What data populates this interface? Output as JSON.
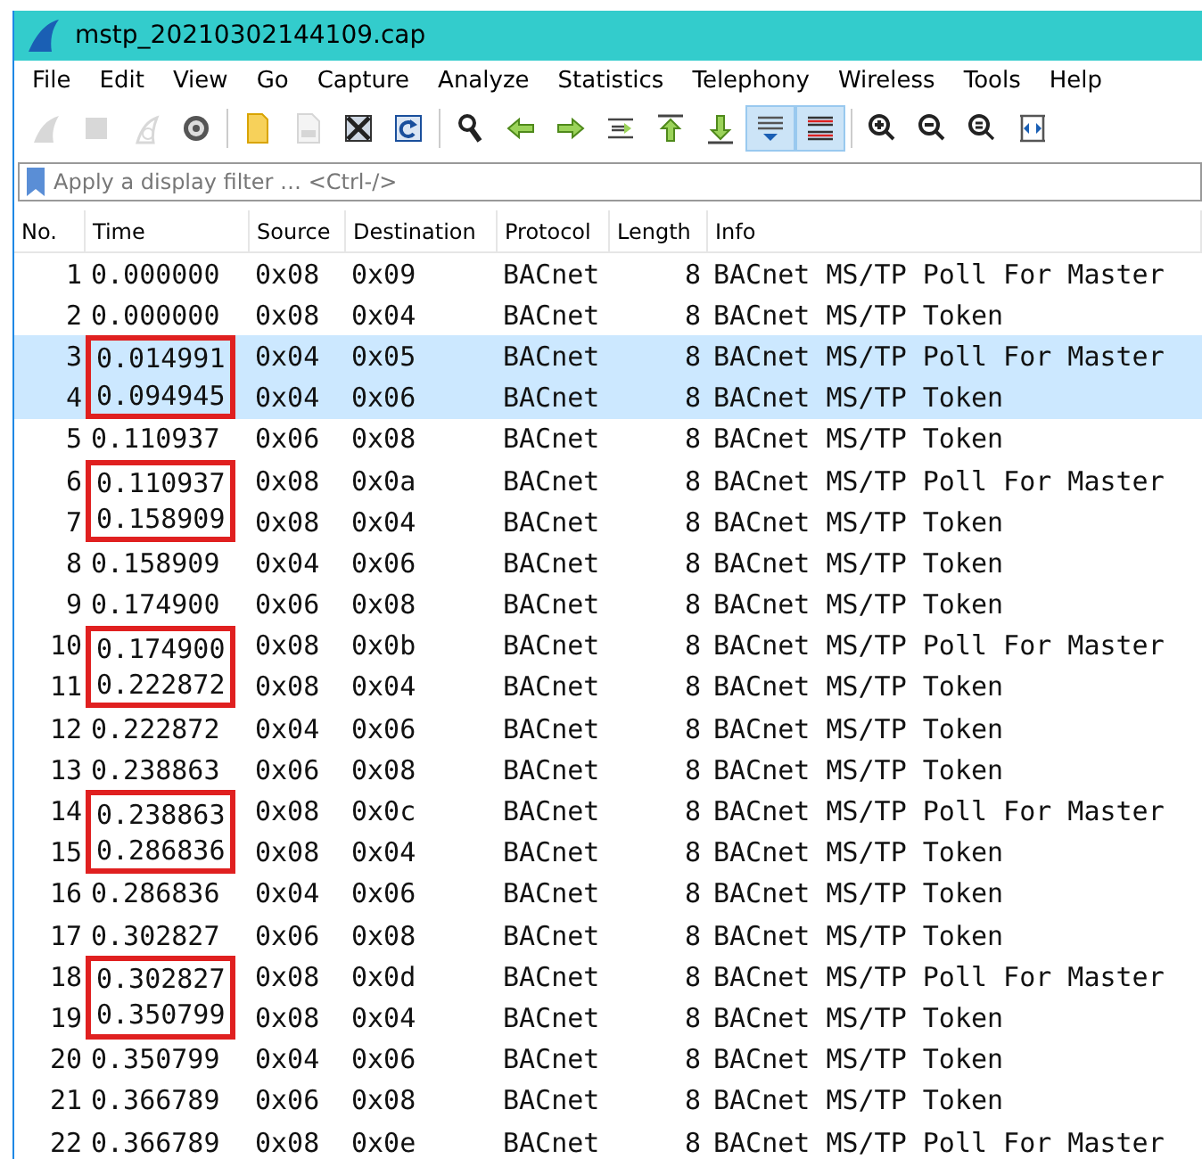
{
  "window": {
    "title": "mstp_20210302144109.cap"
  },
  "menu": [
    "File",
    "Edit",
    "View",
    "Go",
    "Capture",
    "Analyze",
    "Statistics",
    "Telephony",
    "Wireless",
    "Tools",
    "Help"
  ],
  "toolbar": [
    {
      "kind": "shark",
      "disabled": true,
      "pressed": false
    },
    {
      "kind": "stop",
      "disabled": true,
      "pressed": false
    },
    {
      "kind": "restart",
      "disabled": true,
      "pressed": false
    },
    {
      "kind": "options",
      "disabled": false,
      "pressed": false
    },
    {
      "kind": "separator"
    },
    {
      "kind": "open",
      "disabled": false,
      "pressed": false
    },
    {
      "kind": "save",
      "disabled": true,
      "pressed": false
    },
    {
      "kind": "close",
      "disabled": false,
      "pressed": false
    },
    {
      "kind": "reload",
      "disabled": false,
      "pressed": false
    },
    {
      "kind": "separator"
    },
    {
      "kind": "find",
      "disabled": false,
      "pressed": false
    },
    {
      "kind": "back",
      "disabled": false,
      "pressed": false
    },
    {
      "kind": "forward",
      "disabled": false,
      "pressed": false
    },
    {
      "kind": "goto",
      "disabled": false,
      "pressed": false
    },
    {
      "kind": "first",
      "disabled": false,
      "pressed": false
    },
    {
      "kind": "last",
      "disabled": false,
      "pressed": false
    },
    {
      "kind": "autoscroll",
      "disabled": false,
      "pressed": true
    },
    {
      "kind": "colorize",
      "disabled": false,
      "pressed": true
    },
    {
      "kind": "separator"
    },
    {
      "kind": "zoom-in",
      "disabled": false,
      "pressed": false
    },
    {
      "kind": "zoom-out",
      "disabled": false,
      "pressed": false
    },
    {
      "kind": "zoom-reset",
      "disabled": false,
      "pressed": false
    },
    {
      "kind": "resize",
      "disabled": false,
      "pressed": false
    }
  ],
  "filter": {
    "placeholder": "Apply a display filter … <Ctrl-/>"
  },
  "table": {
    "columns": [
      "No.",
      "Time",
      "Source",
      "Destination",
      "Protocol",
      "Length",
      "Info"
    ],
    "rows": [
      {
        "no": "1",
        "time": "0.000000",
        "source": "0x08",
        "destination": "0x09",
        "protocol": "BACnet",
        "length": "8",
        "info": "BACnet MS/TP Poll For Master",
        "selected": false,
        "boxed": false
      },
      {
        "no": "2",
        "time": "0.000000",
        "source": "0x08",
        "destination": "0x04",
        "protocol": "BACnet",
        "length": "8",
        "info": "BACnet MS/TP Token",
        "selected": false,
        "boxed": false
      },
      {
        "no": "3",
        "time": "0.014991",
        "source": "0x04",
        "destination": "0x05",
        "protocol": "BACnet",
        "length": "8",
        "info": "BACnet MS/TP Poll For Master",
        "selected": true,
        "boxed": true
      },
      {
        "no": "4",
        "time": "0.094945",
        "source": "0x04",
        "destination": "0x06",
        "protocol": "BACnet",
        "length": "8",
        "info": "BACnet MS/TP Token",
        "selected": true,
        "boxed": true
      },
      {
        "no": "5",
        "time": "0.110937",
        "source": "0x06",
        "destination": "0x08",
        "protocol": "BACnet",
        "length": "8",
        "info": "BACnet MS/TP Token",
        "selected": false,
        "boxed": false
      },
      {
        "no": "6",
        "time": "0.110937",
        "source": "0x08",
        "destination": "0x0a",
        "protocol": "BACnet",
        "length": "8",
        "info": "BACnet MS/TP Poll For Master",
        "selected": false,
        "boxed": true
      },
      {
        "no": "7",
        "time": "0.158909",
        "source": "0x08",
        "destination": "0x04",
        "protocol": "BACnet",
        "length": "8",
        "info": "BACnet MS/TP Token",
        "selected": false,
        "boxed": true
      },
      {
        "no": "8",
        "time": "0.158909",
        "source": "0x04",
        "destination": "0x06",
        "protocol": "BACnet",
        "length": "8",
        "info": "BACnet MS/TP Token",
        "selected": false,
        "boxed": false
      },
      {
        "no": "9",
        "time": "0.174900",
        "source": "0x06",
        "destination": "0x08",
        "protocol": "BACnet",
        "length": "8",
        "info": "BACnet MS/TP Token",
        "selected": false,
        "boxed": false
      },
      {
        "no": "10",
        "time": "0.174900",
        "source": "0x08",
        "destination": "0x0b",
        "protocol": "BACnet",
        "length": "8",
        "info": "BACnet MS/TP Poll For Master",
        "selected": false,
        "boxed": true
      },
      {
        "no": "11",
        "time": "0.222872",
        "source": "0x08",
        "destination": "0x04",
        "protocol": "BACnet",
        "length": "8",
        "info": "BACnet MS/TP Token",
        "selected": false,
        "boxed": true
      },
      {
        "no": "12",
        "time": "0.222872",
        "source": "0x04",
        "destination": "0x06",
        "protocol": "BACnet",
        "length": "8",
        "info": "BACnet MS/TP Token",
        "selected": false,
        "boxed": false
      },
      {
        "no": "13",
        "time": "0.238863",
        "source": "0x06",
        "destination": "0x08",
        "protocol": "BACnet",
        "length": "8",
        "info": "BACnet MS/TP Token",
        "selected": false,
        "boxed": false
      },
      {
        "no": "14",
        "time": "0.238863",
        "source": "0x08",
        "destination": "0x0c",
        "protocol": "BACnet",
        "length": "8",
        "info": "BACnet MS/TP Poll For Master",
        "selected": false,
        "boxed": true
      },
      {
        "no": "15",
        "time": "0.286836",
        "source": "0x08",
        "destination": "0x04",
        "protocol": "BACnet",
        "length": "8",
        "info": "BACnet MS/TP Token",
        "selected": false,
        "boxed": true
      },
      {
        "no": "16",
        "time": "0.286836",
        "source": "0x04",
        "destination": "0x06",
        "protocol": "BACnet",
        "length": "8",
        "info": "BACnet MS/TP Token",
        "selected": false,
        "boxed": false
      },
      {
        "no": "17",
        "time": "0.302827",
        "source": "0x06",
        "destination": "0x08",
        "protocol": "BACnet",
        "length": "8",
        "info": "BACnet MS/TP Token",
        "selected": false,
        "boxed": false
      },
      {
        "no": "18",
        "time": "0.302827",
        "source": "0x08",
        "destination": "0x0d",
        "protocol": "BACnet",
        "length": "8",
        "info": "BACnet MS/TP Poll For Master",
        "selected": false,
        "boxed": true
      },
      {
        "no": "19",
        "time": "0.350799",
        "source": "0x08",
        "destination": "0x04",
        "protocol": "BACnet",
        "length": "8",
        "info": "BACnet MS/TP Token",
        "selected": false,
        "boxed": true
      },
      {
        "no": "20",
        "time": "0.350799",
        "source": "0x04",
        "destination": "0x06",
        "protocol": "BACnet",
        "length": "8",
        "info": "BACnet MS/TP Token",
        "selected": false,
        "boxed": false
      },
      {
        "no": "21",
        "time": "0.366789",
        "source": "0x06",
        "destination": "0x08",
        "protocol": "BACnet",
        "length": "8",
        "info": "BACnet MS/TP Token",
        "selected": false,
        "boxed": false
      },
      {
        "no": "22",
        "time": "0.366789",
        "source": "0x08",
        "destination": "0x0e",
        "protocol": "BACnet",
        "length": "8",
        "info": "BACnet MS/TP Poll For Master",
        "selected": false,
        "boxed": false
      }
    ]
  }
}
